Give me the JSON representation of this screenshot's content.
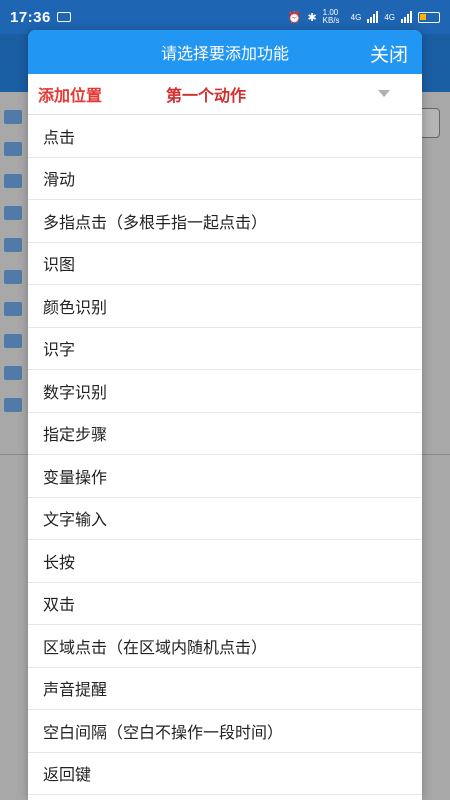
{
  "status_bar": {
    "time": "17:36",
    "net_speed": "1.00 KB/s",
    "signal_1": "4G",
    "signal_2": "4G"
  },
  "dialog": {
    "title": "请选择要添加功能",
    "close_label": "关闭",
    "position_label": "添加位置",
    "position_value": "第一个动作",
    "items": [
      "点击",
      "滑动",
      "多指点击（多根手指一起点击）",
      "识图",
      "颜色识别",
      "识字",
      "数字识别",
      "指定步骤",
      "变量操作",
      "文字输入",
      "长按",
      "双击",
      "区域点击（在区域内随机点击）",
      "声音提醒",
      "空白间隔（空白不操作一段时间）",
      "返回键"
    ]
  },
  "colors": {
    "header_blue": "#2196f3",
    "status_blue": "#1e66b4",
    "position_red": "#e53935"
  }
}
